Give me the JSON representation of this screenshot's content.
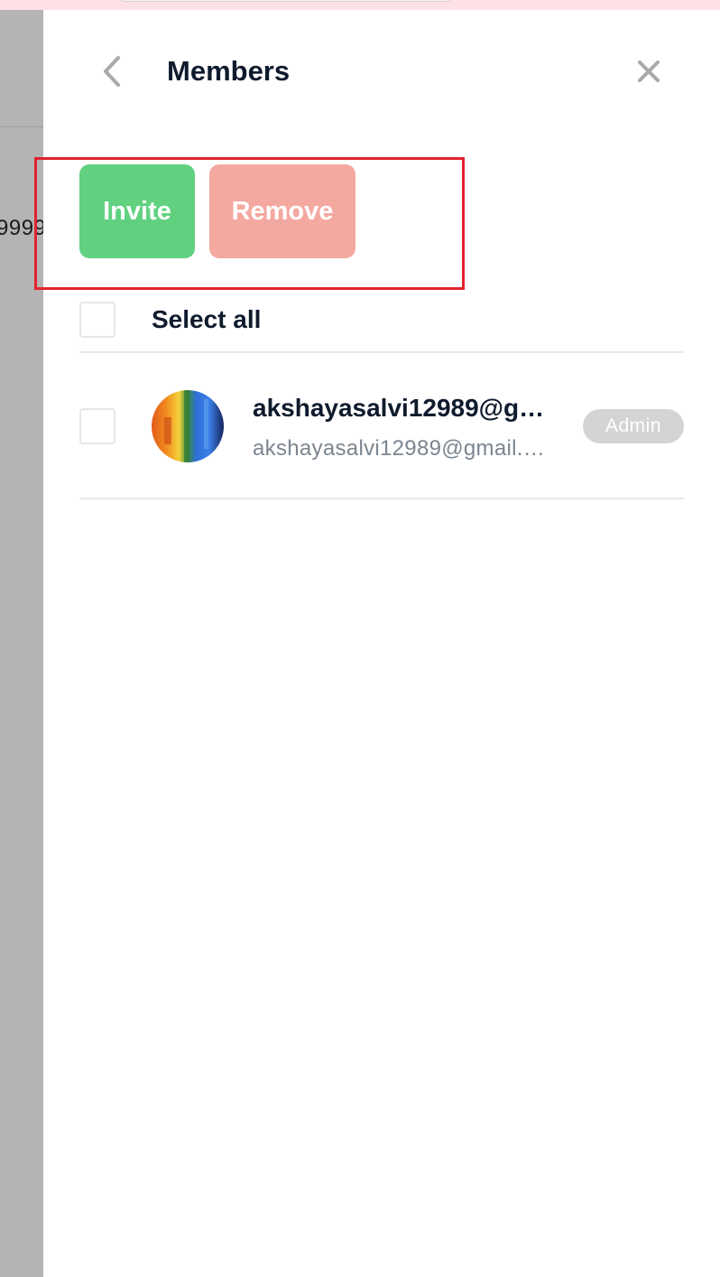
{
  "header": {
    "title": "Members",
    "back_icon": "chevron-left-icon",
    "close_icon": "close-icon"
  },
  "actions": {
    "invite_label": "Invite",
    "remove_label": "Remove",
    "invite_color": "#61d180",
    "remove_color": "#f4a9a0",
    "highlight_color": "#e0232e"
  },
  "select_all": {
    "label": "Select all",
    "checked": false
  },
  "members": [
    {
      "name": "akshayasalvi12989@gmail.com",
      "email": "akshayasalvi12989@gmail.com",
      "role": "Admin",
      "checked": false
    }
  ],
  "background_page": {
    "partial_text": "9999"
  }
}
